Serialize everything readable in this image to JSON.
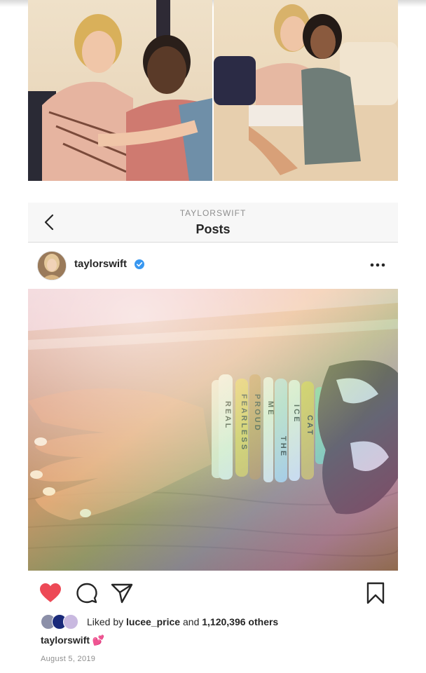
{
  "nav": {
    "subtitle": "TAYLORSWIFT",
    "title": "Posts"
  },
  "post": {
    "username": "taylorswift",
    "more_label": "•••",
    "likes": {
      "prefix": "Liked by ",
      "liker": "lucee_price",
      "middle": " and ",
      "count": "1,120,396 others"
    },
    "caption_user": "taylorswift",
    "caption_text": "💕",
    "date": "August 5, 2019"
  },
  "bracelets": {
    "words": [
      "REAL",
      "FEARLESS",
      "PROUD",
      "ME",
      "THE",
      "ICE",
      "CAT"
    ]
  },
  "colors": {
    "like": "#ed4956",
    "verified": "#3897f0"
  },
  "icons": {
    "back": "chevron-left-icon",
    "like": "heart-icon",
    "comment": "comment-icon",
    "share": "paper-plane-icon",
    "save": "bookmark-icon",
    "more": "ellipsis-icon"
  }
}
